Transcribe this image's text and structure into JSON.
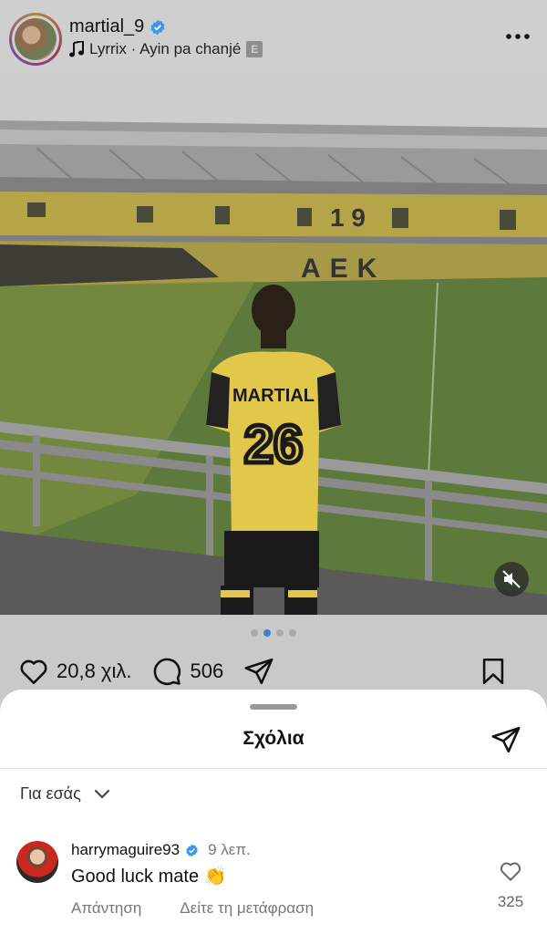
{
  "post": {
    "username": "martial_9",
    "music": "Lyrrix · Ayin pa chanjé",
    "explicit_badge": "E",
    "likes": "20,8 χιλ.",
    "comments_count": "506",
    "carousel": {
      "count": 4,
      "active_index": 1
    },
    "photo": {
      "jersey_name": "MARTIAL",
      "jersey_number": "26"
    }
  },
  "sheet": {
    "title": "Σχόλια",
    "filter_label": "Για εσάς"
  },
  "comment": {
    "username": "harrymaguire93",
    "time": "9 λεπ.",
    "text": "Good luck mate 👏",
    "reply_label": "Απάντηση",
    "translate_label": "Δείτε τη μετάφραση",
    "like_count": "325"
  },
  "colors": {
    "accent_blue": "#3897f0",
    "stadium_yellow": "#c9b24a",
    "pitch_green": "#5d7a3c"
  }
}
